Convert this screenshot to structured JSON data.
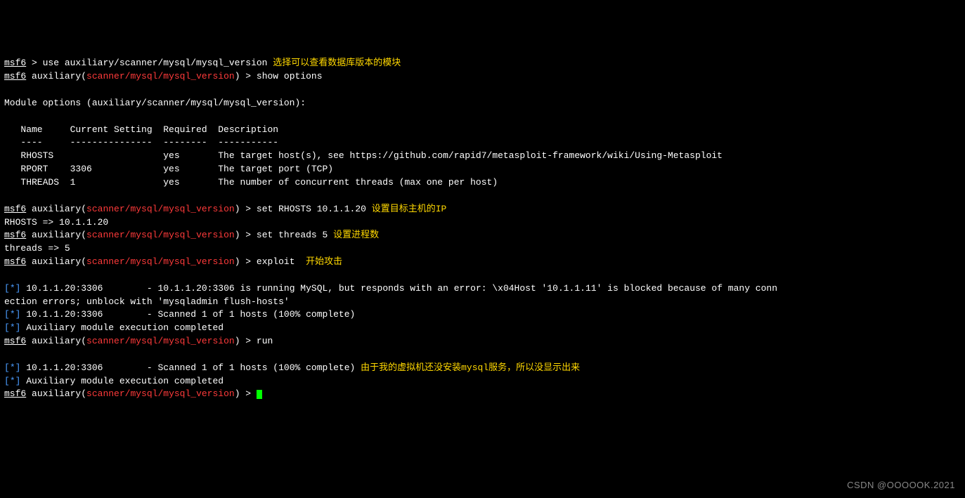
{
  "prompt_msf6": "msf6",
  "prompt_sep": " > ",
  "aux_prefix": " auxiliary(",
  "aux_module_path": "scanner/mysql/mysql_version",
  "aux_suffix": ") > ",
  "cmd_use": "use auxiliary/scanner/mysql/mysql_version ",
  "annot_use": "选择可以查看数据库版本的模块",
  "cmd_show_options": "show options",
  "module_options_header": "Module options (auxiliary/scanner/mysql/mysql_version):",
  "options_table": {
    "headers": "   Name     Current Setting  Required  Description",
    "divider": "   ----     ---------------  --------  -----------",
    "rows": [
      "   RHOSTS                    yes       The target host(s), see https://github.com/rapid7/metasploit-framework/wiki/Using-Metasploit",
      "   RPORT    3306             yes       The target port (TCP)",
      "   THREADS  1                yes       The number of concurrent threads (max one per host)"
    ]
  },
  "cmd_set_rhosts": "set RHOSTS 10.1.1.20 ",
  "annot_rhosts": "设置目标主机的IP",
  "out_rhosts": "RHOSTS => 10.1.1.20",
  "cmd_set_threads": "set threads 5 ",
  "annot_threads": "设置进程数",
  "out_threads": "threads => 5",
  "cmd_exploit": "exploit  ",
  "annot_exploit": "开始攻击",
  "star_prefix_open": "[",
  "star_prefix_mid": "*",
  "star_prefix_close": "] ",
  "line_err1": "10.1.1.20:3306        - 10.1.1.20:3306 is running MySQL, but responds with an error: \\x04Host '10.1.1.11' is blocked because of many conn",
  "line_err2": "ection errors; unblock with 'mysqladmin flush-hosts'",
  "line_scan1": "10.1.1.20:3306        - Scanned 1 of 1 hosts (100% complete)",
  "line_complete": "Auxiliary module execution completed",
  "cmd_run": "run",
  "line_scan2": "10.1.1.20:3306        - Scanned 1 of 1 hosts (100% complete) ",
  "annot_novm": "由于我的虚拟机还没安装mysql服务，所以没显示出来",
  "watermark": "CSDN @OOOOOK.2021"
}
